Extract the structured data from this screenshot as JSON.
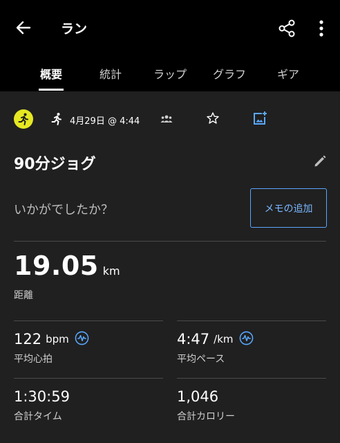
{
  "appbar": {
    "title": "ラン"
  },
  "tabs": [
    {
      "label": "概要"
    },
    {
      "label": "統計"
    },
    {
      "label": "ラップ"
    },
    {
      "label": "グラフ"
    },
    {
      "label": "ギア"
    }
  ],
  "activity": {
    "datetime": "4月29日 @ 4:44",
    "name": "90分ジョグ",
    "prompt": "いかがでしたか？",
    "memo_button": "メモの追加"
  },
  "stats": {
    "distance": {
      "value": "19.05",
      "unit": "km",
      "label": "距離"
    },
    "heart_rate": {
      "value": "122",
      "unit": "bpm",
      "label": "平均心拍"
    },
    "pace": {
      "value": "4:47",
      "unit": "/km",
      "label": "平均ペース"
    },
    "time": {
      "value": "1:30:59",
      "label": "合計タイム"
    },
    "calories": {
      "value": "1,046",
      "label": "合計カロリー"
    }
  },
  "colors": {
    "accent": "#5aa8ff",
    "activity_badge": "#e5e822",
    "background": "#202020",
    "header": "#000000"
  },
  "icons": [
    "back-arrow-icon",
    "share-icon",
    "more-vert-icon",
    "running-icon",
    "people-icon",
    "star-icon",
    "add-photo-icon",
    "pencil-icon",
    "heart-wave-icon"
  ]
}
